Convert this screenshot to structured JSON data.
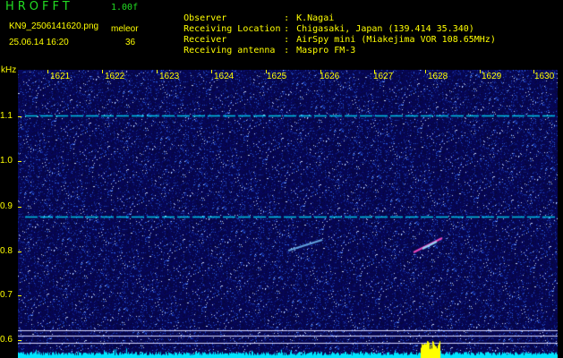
{
  "header": {
    "app_title": "HROFFT",
    "version": "1.00f",
    "file_name": "KN9_2506141620.png",
    "program": "meleor",
    "timestamp": "25.06.14 16:20",
    "count": "36"
  },
  "station": {
    "observer_label": "Observer",
    "observer": "K.Nagai",
    "location_label": "Receiving Location",
    "location": "Chigasaki, Japan (139.414 35.340)",
    "receiver_label": "Receiver",
    "receiver": "AirSpy mini (Miakejima VOR 108.65MHz)",
    "antenna_label": "Receiving antenna",
    "antenna": "Maspro FM-3",
    "separator": ":"
  },
  "spectrogram": {
    "y_unit": "kHz",
    "y_ticks": [
      "1.1",
      "1.0",
      "0.9",
      "0.8",
      "0.7",
      "0.6"
    ],
    "x_ticks": [
      "1621",
      "1622",
      "1623",
      "1624",
      "1625",
      "1626",
      "1627",
      "1628",
      "1629",
      "1630"
    ],
    "colors": {
      "background": "#070748",
      "signal": "#00e5ff",
      "label": "#ffff00",
      "title": "#22dd22"
    }
  }
}
